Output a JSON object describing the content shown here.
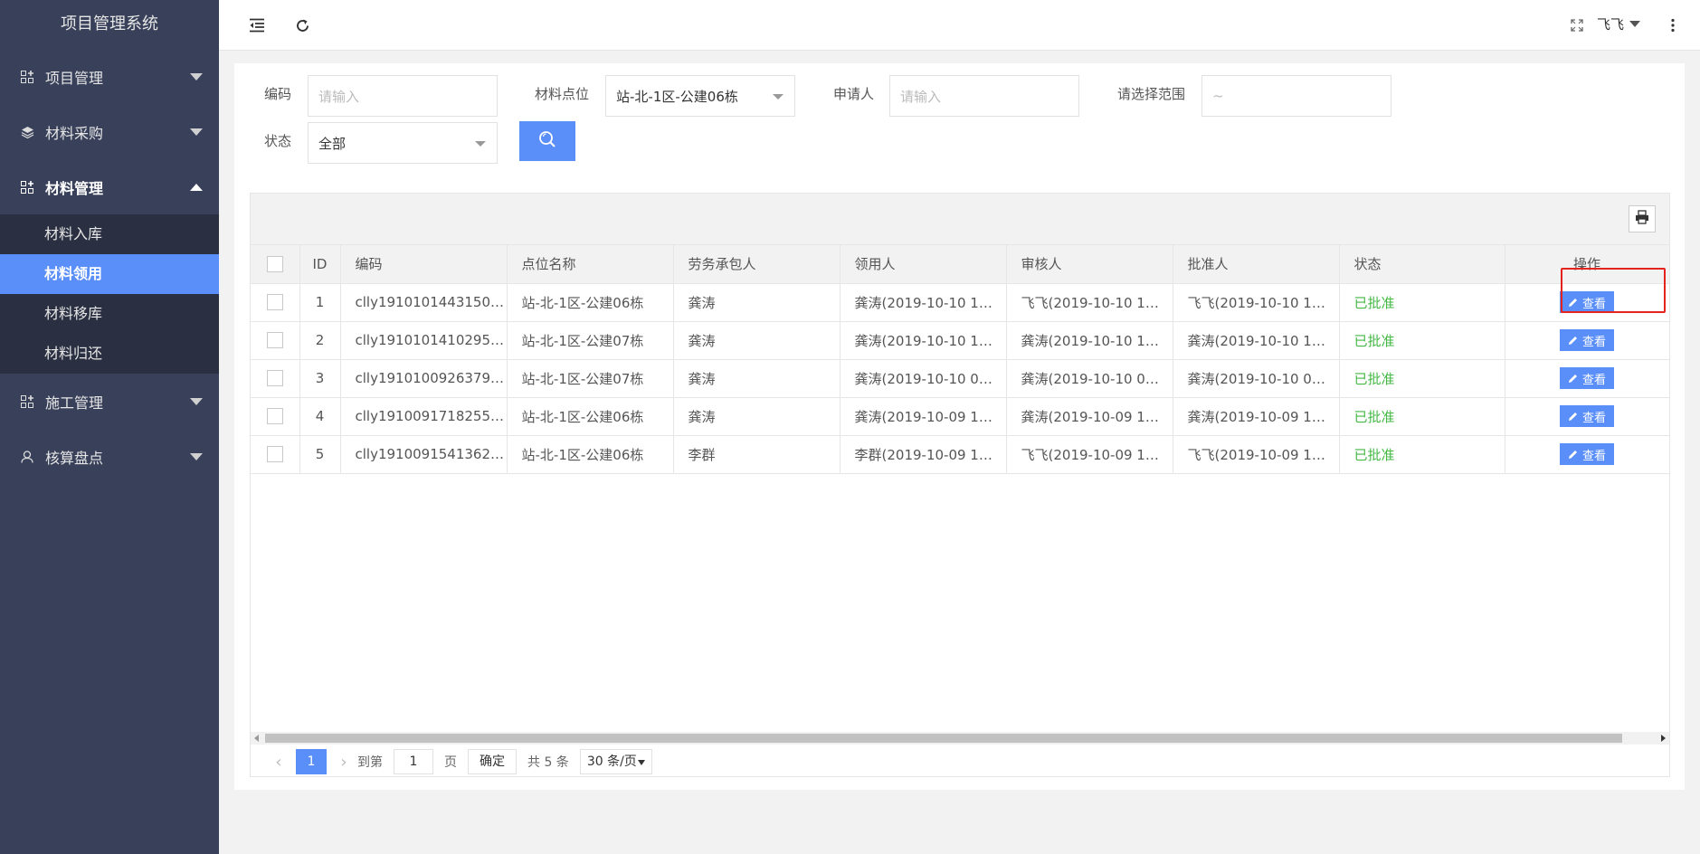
{
  "sidebar": {
    "brand": "项目管理系统",
    "menus": [
      {
        "label": "项目管理",
        "icon": "grid-plus-icon"
      },
      {
        "label": "材料采购",
        "icon": "layers-icon"
      },
      {
        "label": "材料管理",
        "icon": "grid-plus-icon"
      },
      {
        "label": "施工管理",
        "icon": "grid-plus-icon"
      },
      {
        "label": "核算盘点",
        "icon": "user-icon"
      }
    ],
    "submenu": [
      "材料入库",
      "材料领用",
      "材料移库",
      "材料归还"
    ]
  },
  "header": {
    "user": "飞飞",
    "icons": [
      "collapse-menu-icon",
      "refresh-icon",
      "fullscreen-icon",
      "more-vertical-icon"
    ]
  },
  "filters": {
    "code_label": "编码",
    "code_placeholder": "请输入",
    "location_label": "材料点位",
    "location_value": "站-北-1区-公建06栋",
    "applicant_label": "申请人",
    "applicant_placeholder": "请输入",
    "range_label": "请选择范围",
    "range_placeholder": "~",
    "status_label": "状态",
    "status_value": "全部"
  },
  "table": {
    "columns": [
      "ID",
      "编码",
      "点位名称",
      "劳务承包人",
      "领用人",
      "审核人",
      "批准人",
      "状态",
      "操作"
    ],
    "rows": [
      {
        "id": "1",
        "code": "clly1910101443150…",
        "location": "站-北-1区-公建06栋",
        "contractor": "龚涛",
        "receiver": "龚涛(2019-10-10 1…",
        "reviewer": "飞飞(2019-10-10 1…",
        "approver": "飞飞(2019-10-10 1…",
        "status": "已批准",
        "action": "查看"
      },
      {
        "id": "2",
        "code": "clly1910101410295…",
        "location": "站-北-1区-公建07栋",
        "contractor": "龚涛",
        "receiver": "龚涛(2019-10-10 1…",
        "reviewer": "龚涛(2019-10-10 1…",
        "approver": "龚涛(2019-10-10 1…",
        "status": "已批准",
        "action": "查看"
      },
      {
        "id": "3",
        "code": "clly1910100926379…",
        "location": "站-北-1区-公建07栋",
        "contractor": "龚涛",
        "receiver": "龚涛(2019-10-10 0…",
        "reviewer": "龚涛(2019-10-10 0…",
        "approver": "龚涛(2019-10-10 0…",
        "status": "已批准",
        "action": "查看"
      },
      {
        "id": "4",
        "code": "clly1910091718255…",
        "location": "站-北-1区-公建06栋",
        "contractor": "龚涛",
        "receiver": "龚涛(2019-10-09 1…",
        "reviewer": "龚涛(2019-10-09 1…",
        "approver": "龚涛(2019-10-09 1…",
        "status": "已批准",
        "action": "查看"
      },
      {
        "id": "5",
        "code": "clly1910091541362…",
        "location": "站-北-1区-公建06栋",
        "contractor": "李群",
        "receiver": "李群(2019-10-09 1…",
        "reviewer": "飞飞(2019-10-09 1…",
        "approver": "飞飞(2019-10-09 1…",
        "status": "已批准",
        "action": "查看"
      }
    ]
  },
  "pagination": {
    "current": "1",
    "goto_label": "到第",
    "goto_value": "1",
    "page_unit": "页",
    "confirm": "确定",
    "total": "共 5 条",
    "page_size": "30 条/页"
  },
  "colors": {
    "sidebar_bg": "#39415a",
    "accent": "#5a8ef8",
    "status_approved": "#45b845",
    "highlight": "#e5231e"
  }
}
